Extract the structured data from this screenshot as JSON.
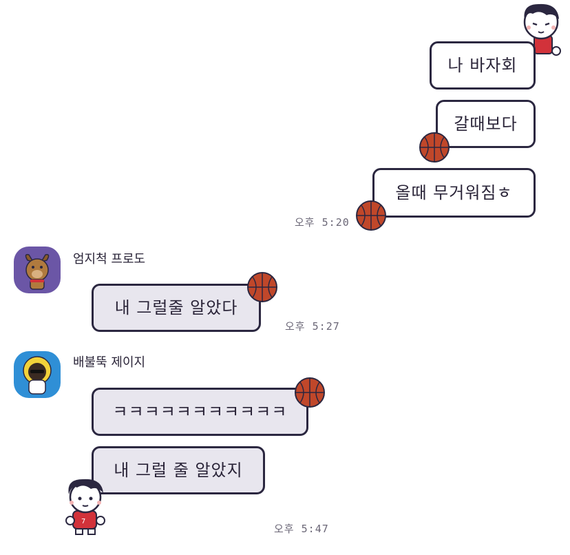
{
  "outgoing": {
    "messages": [
      "나 바자회",
      "갈때보다",
      "올때 무거워짐ㅎ"
    ],
    "time": "오후 5:20"
  },
  "group1": {
    "sender": "엄지척 프로도",
    "messages": [
      "내 그럴줄 알았다"
    ],
    "time": "오후 5:27"
  },
  "group2": {
    "sender": "배불뚝 제이지",
    "messages": [
      "ㅋㅋㅋㅋㅋㅋㅋㅋㅋㅋㅋ",
      "내 그럴 줄 알았지"
    ],
    "time": "오후 5:47"
  },
  "colors": {
    "border": "#2b2740",
    "incoming_bubble": "#e8e6ee",
    "outgoing_bubble": "#ffffff",
    "basketball": "#c0472a",
    "frodo_avatar_bg": "#6b56a6",
    "jayg_avatar_bg": "#2f8fd6"
  },
  "icons": {
    "sticker_boy": "basketball-boy-sticker",
    "ball": "basketball-icon",
    "frodo": "frodo-dog-avatar",
    "jayg": "jayg-avatar"
  }
}
